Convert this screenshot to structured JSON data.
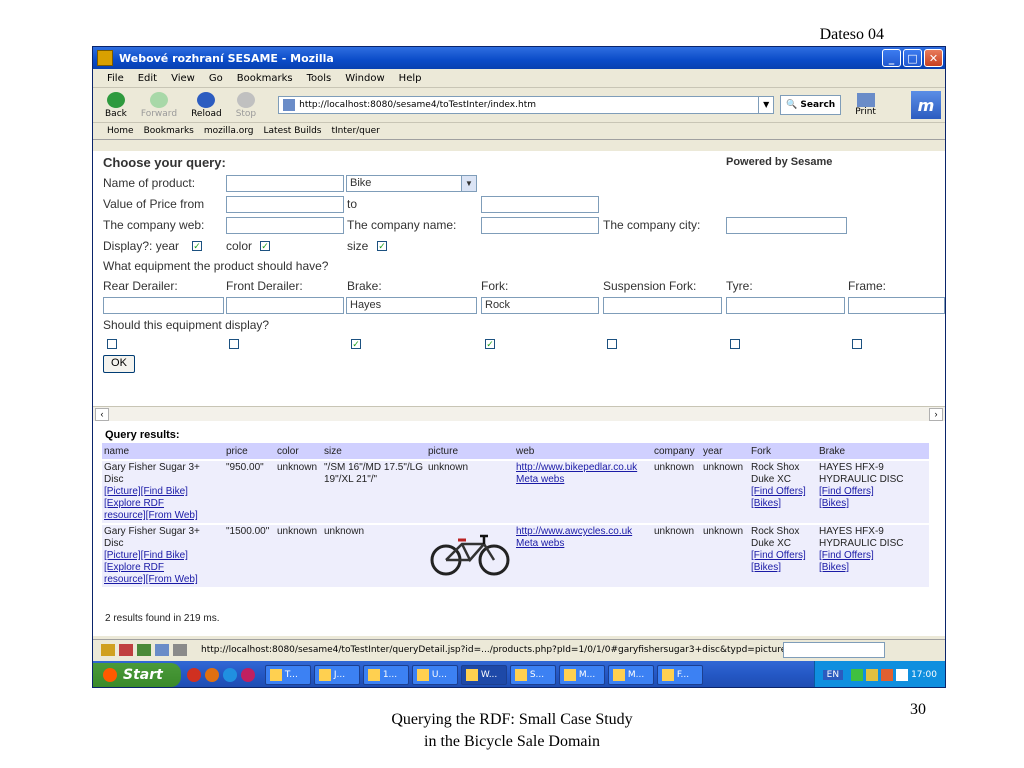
{
  "slide": {
    "header": "Dateso 04",
    "footer_line1": "Querying the RDF: Small Case Study",
    "footer_line2": "in the Bicycle Sale Domain",
    "page_number": "30"
  },
  "window": {
    "title": "Webové rozhraní SESAME - Mozilla",
    "menu": [
      "File",
      "Edit",
      "View",
      "Go",
      "Bookmarks",
      "Tools",
      "Window",
      "Help"
    ],
    "nav": {
      "back": "Back",
      "forward": "Forward",
      "reload": "Reload",
      "stop": "Stop",
      "search": "Search",
      "print": "Print"
    },
    "url": "http://localhost:8080/sesame4/toTestInter/index.htm",
    "personal_bar": [
      "Home",
      "Bookmarks",
      "mozilla.org",
      "Latest Builds",
      "tInter/quer"
    ]
  },
  "form": {
    "heading": "Choose your query:",
    "powered_by": "Powered by Sesame",
    "name_of_product_label": "Name of product:",
    "name_of_product_value": "",
    "category_value": "Bike",
    "price_from_label": "Value of Price from",
    "price_to_label": "to",
    "company_web_label": "The company web:",
    "company_name_label": "The company name:",
    "company_city_label": "The company city:",
    "display_label": "Display?: year",
    "color_label": "color",
    "size_label": "size",
    "display_year": true,
    "display_color": true,
    "display_size": true,
    "equipment_question": "What equipment the product should have?",
    "equipment_labels": [
      "Rear Derailer:",
      "Front Derailer:",
      "Brake:",
      "Fork:",
      "Suspension Fork:",
      "Tyre:",
      "Frame:"
    ],
    "equipment_values": [
      "",
      "",
      "Hayes",
      "Rock",
      "",
      "",
      ""
    ],
    "display_question": "Should this equipment display?",
    "equipment_display": [
      false,
      false,
      true,
      true,
      false,
      false,
      false
    ],
    "ok_label": "OK"
  },
  "results": {
    "title": "Query results:",
    "columns": [
      "name",
      "price",
      "color",
      "size",
      "picture",
      "web",
      "company",
      "year",
      "Fork",
      "Brake"
    ],
    "rows": [
      {
        "name": "Gary Fisher Sugar 3+ Disc",
        "name_links": [
          "[Picture][Find Bike]",
          "[Explore RDF",
          "resource][From Web]"
        ],
        "price": "\"950.00\"",
        "color": "unknown",
        "size": "\"/SM 16\"/MD 17.5\"/LG 19\"/XL 21\"/\"",
        "picture": "unknown",
        "web": "http://www.bikepedlar.co.uk",
        "web_meta": "Meta webs",
        "company": "unknown",
        "year": "unknown",
        "fork": "Rock Shox Duke XC",
        "fork_links": [
          "[Find Offers]",
          "[Bikes]"
        ],
        "brake": "HAYES HFX-9 HYDRAULIC DISC",
        "brake_links": [
          "[Find Offers]",
          "[Bikes]"
        ]
      },
      {
        "name": "Gary Fisher Sugar 3+ Disc",
        "name_links": [
          "[Picture][Find Bike]",
          "[Explore RDF",
          "resource][From Web]"
        ],
        "price": "\"1500.00\"",
        "color": "unknown",
        "size": "unknown",
        "picture": "",
        "web": "http://www.awcycles.co.uk",
        "web_meta": "Meta webs",
        "company": "unknown",
        "year": "unknown",
        "fork": "Rock Shox Duke XC",
        "fork_links": [
          "[Find Offers]",
          "[Bikes]"
        ],
        "brake": "HAYES HFX-9 HYDRAULIC DISC",
        "brake_links": [
          "[Find Offers]",
          "[Bikes]"
        ]
      }
    ],
    "footer": "2 results found in 219 ms."
  },
  "statusbar": {
    "text": "http://localhost:8080/sesame4/toTestInter/queryDetail.jsp?id=.../products.php?pId=1/0/1/0#garyfishersugar3+disc&typd=picture"
  },
  "taskbar": {
    "start": "Start",
    "tasks": [
      "T...",
      "J...",
      "1...",
      "U...",
      "W...",
      "S...",
      "M...",
      "M...",
      "F..."
    ],
    "lang": "EN",
    "time": "17:00"
  }
}
